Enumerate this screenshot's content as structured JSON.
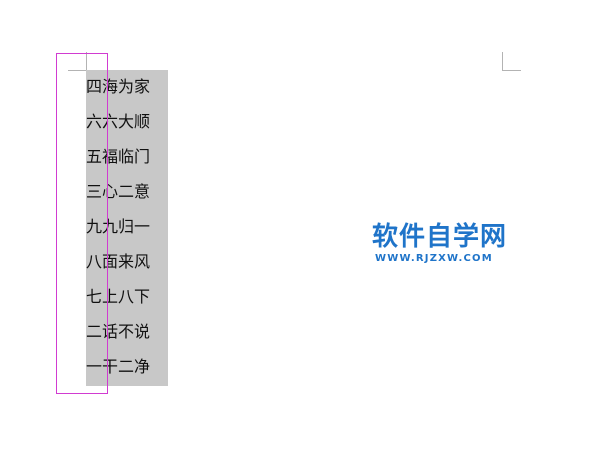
{
  "document": {
    "lines": [
      "四海为家",
      "六六大顺",
      "五福临门",
      "三心二意",
      "九九归一",
      "八面来风",
      "七上八下",
      "二话不说",
      "一干二净"
    ]
  },
  "watermark": {
    "title": "软件自学网",
    "url": "WWW.RJZXW.COM",
    "color": "#1f74c9"
  },
  "colors": {
    "highlight": "#c8c8c8",
    "selection_border": "#d13bd1"
  }
}
